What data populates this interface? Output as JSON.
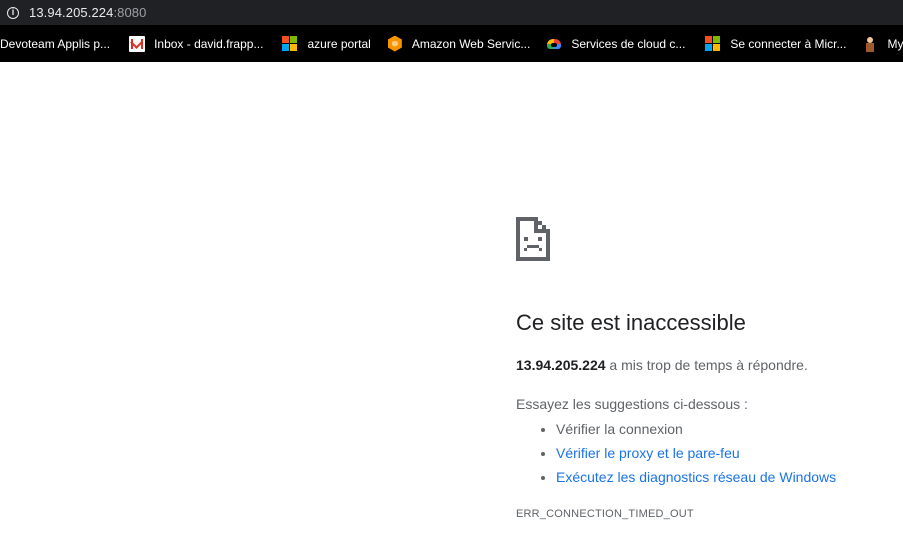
{
  "address_bar": {
    "icon": "info-icon",
    "host": "13.94.205.224",
    "port": ":8080"
  },
  "bookmarks": [
    {
      "label": "Devoteam Applis p...",
      "icon": ""
    },
    {
      "label": "Inbox - david.frapp...",
      "icon": "gmail-icon"
    },
    {
      "label": "azure portal",
      "icon": "microsoft-icon"
    },
    {
      "label": "Amazon Web Servic...",
      "icon": "aws-icon"
    },
    {
      "label": "Services de cloud c...",
      "icon": "google-cloud-icon"
    },
    {
      "label": "Se connecter à Micr...",
      "icon": "microsoft-icon"
    },
    {
      "label": "My Bl",
      "icon": "character-icon"
    }
  ],
  "error": {
    "icon": "sad-document-icon",
    "title": "Ce site est inaccessible",
    "host": "13.94.205.224",
    "message": " a mis trop de temps à répondre.",
    "suggestions_intro": "Essayez les suggestions ci-dessous :",
    "suggestions": [
      {
        "text": "Vérifier la connexion",
        "link": false
      },
      {
        "text": "Vérifier le proxy et le pare-feu",
        "link": true
      },
      {
        "text": "Exécutez les diagnostics réseau de Windows",
        "link": true
      }
    ],
    "code": "ERR_CONNECTION_TIMED_OUT"
  },
  "colors": {
    "address_bar_bg": "#202124",
    "bookmarks_bg": "#000000",
    "link": "#1a73e8",
    "title": "#202124",
    "body_text": "#5f6368"
  }
}
